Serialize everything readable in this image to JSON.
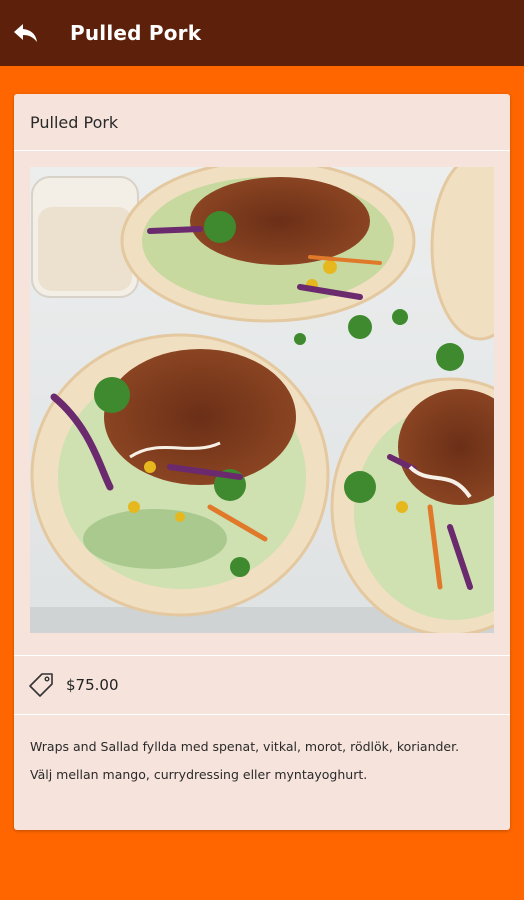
{
  "appbar": {
    "title": "Pulled Pork",
    "back_icon": "reply-arrow-icon",
    "background": "#5c200b"
  },
  "page": {
    "background": "#ff6600"
  },
  "card": {
    "title": "Pulled Pork",
    "image_subject": "pulled pork tacos",
    "price_icon": "price-tag-icon",
    "price": "$75.00",
    "description_lines": [
      "Wraps and Sallad fyllda med spenat, vitkal, morot, rödlök, koriander.",
      "Välj mellan mango, currydressing eller myntayoghurt."
    ]
  }
}
